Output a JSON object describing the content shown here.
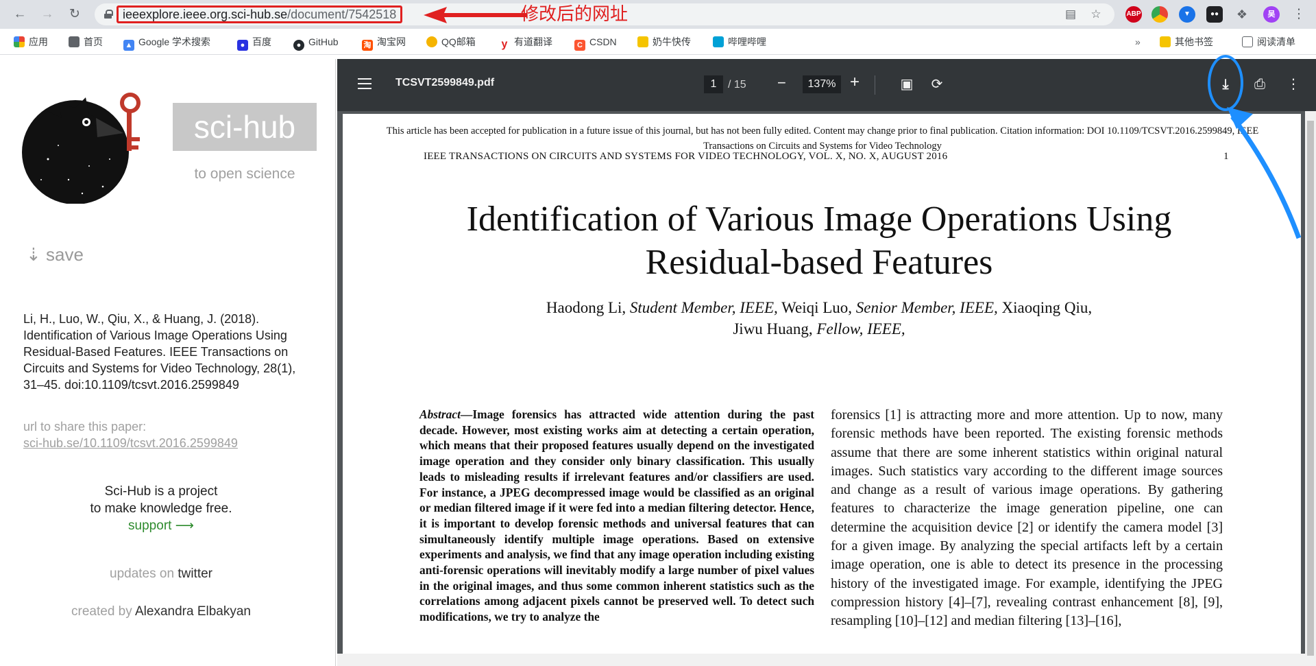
{
  "browser": {
    "url_main": "ieeexplore.ieee.org.sci-hub.se",
    "url_path": "/document/7542518",
    "annotation_text": "修改后的网址",
    "icons": [
      "back-arrow-icon",
      "forward-arrow-icon",
      "reload-icon",
      "lock-icon",
      "translate-icon",
      "star-icon",
      "extensions-icon"
    ],
    "extension_badges": {
      "abp": "ABP",
      "profile": "吴"
    },
    "bookmarks": [
      {
        "label": "应用",
        "icon_text": "",
        "color": "#4285f4"
      },
      {
        "label": "首页",
        "icon_text": "",
        "color": "#5f6368"
      },
      {
        "label": "Google 学术搜索",
        "icon_text": "",
        "color": "#4285f4"
      },
      {
        "label": "百度",
        "icon_text": "",
        "color": "#2932e1"
      },
      {
        "label": "GitHub",
        "icon_text": "",
        "color": "#24292e"
      },
      {
        "label": "淘宝网",
        "icon_text": "淘",
        "color": "#ff5000"
      },
      {
        "label": "QQ邮箱",
        "icon_text": "",
        "color": "#f5b400"
      },
      {
        "label": "有道翻译",
        "icon_text": "y",
        "color": "#e02020"
      },
      {
        "label": "CSDN",
        "icon_text": "C",
        "color": "#fc5531"
      },
      {
        "label": "奶牛快传",
        "icon_text": "",
        "color": "#f5c400"
      },
      {
        "label": "哔哩哔哩",
        "icon_text": "",
        "color": "#00a1d6"
      }
    ],
    "more_chevron": "»",
    "other_bookmarks": "其他书签",
    "reading_list": "阅读清单"
  },
  "scihub": {
    "brand": "sci-hub",
    "tagline": "to open science",
    "save_label": "⇣ save",
    "citation": "Li, H., Luo, W., Qiu, X., & Huang, J. (2018). Identification of Various Image Operations Using Residual-Based Features. IEEE Transactions on Circuits and Systems for Video Technology, 28(1), 31–45. doi:10.1109/tcsvt.2016.2599849",
    "share_label": "url to share this paper:",
    "share_link": "sci-hub.se/10.1109/tcsvt.2016.2599849",
    "project_line1": "Sci-Hub is a project",
    "project_line2": "to make knowledge free.",
    "support": "support ⟶",
    "updates_prefix": "updates on",
    "updates_link": "twitter",
    "created_prefix": "created by",
    "created_name": "Alexandra Elbakyan"
  },
  "pdf": {
    "filename": "TCSVT2599849.pdf",
    "page_current": "1",
    "page_total": "/ 15",
    "zoom": "137%",
    "zoom_out": "−",
    "zoom_in": "+",
    "annotation_color": "#1e8fff",
    "page": {
      "note_line1": "This article has been accepted for publication in a future issue of this journal, but has not been fully edited. Content may change prior to final publication. Citation information: DOI 10.1109/TCSVT.2016.2599849, IEEE",
      "note_line2": "Transactions on Circuits and Systems for Video Technology",
      "running_head": "IEEE TRANSACTIONS ON CIRCUITS AND SYSTEMS FOR VIDEO TECHNOLOGY, VOL. X, NO. X, AUGUST 2016",
      "page_number": "1",
      "title_line1": "Identification of Various Image Operations Using",
      "title_line2": "Residual-based Features",
      "author1": "Haodong Li,",
      "author1_role": "Student Member, IEEE,",
      "author2": "Weiqi Luo,",
      "author2_role": "Senior Member, IEEE,",
      "author3": "Xiaoqing Qiu,",
      "author4": "Jiwu Huang,",
      "author4_role": "Fellow, IEEE,",
      "abstract_lead": "Abstract",
      "abstract_text": "—Image forensics has attracted wide attention during the past decade. However, most existing works aim at detecting a certain operation, which means that their proposed features usually depend on the investigated image operation and they consider only binary classification. This usually leads to misleading results if irrelevant features and/or classifiers are used. For instance, a JPEG decompressed image would be classified as an original or median filtered image if it were fed into a median filtering detector. Hence, it is important to develop forensic methods and universal features that can simultaneously identify multiple image operations. Based on extensive experiments and analysis, we find that any image operation including existing anti-forensic operations will inevitably modify a large number of pixel values in the original images, and thus some common inherent statistics such as the correlations among adjacent pixels cannot be preserved well. To detect such modifications, we try to analyze the",
      "intro_text": "forensics [1] is attracting more and more attention. Up to now, many forensic methods have been reported. The existing forensic methods assume that there are some inherent statistics within original natural images. Such statistics vary according to the different image sources and change as a result of various image operations. By gathering features to characterize the image generation pipeline, one can determine the acquisition device [2] or identify the camera model [3] for a given image. By analyzing the special artifacts left by a certain image operation, one is able to detect its presence in the processing history of the investigated image. For example, identifying the JPEG compression history [4]–[7], revealing contrast enhancement [8], [9], resampling [10]–[12] and median filtering [13]–[16],"
    }
  }
}
